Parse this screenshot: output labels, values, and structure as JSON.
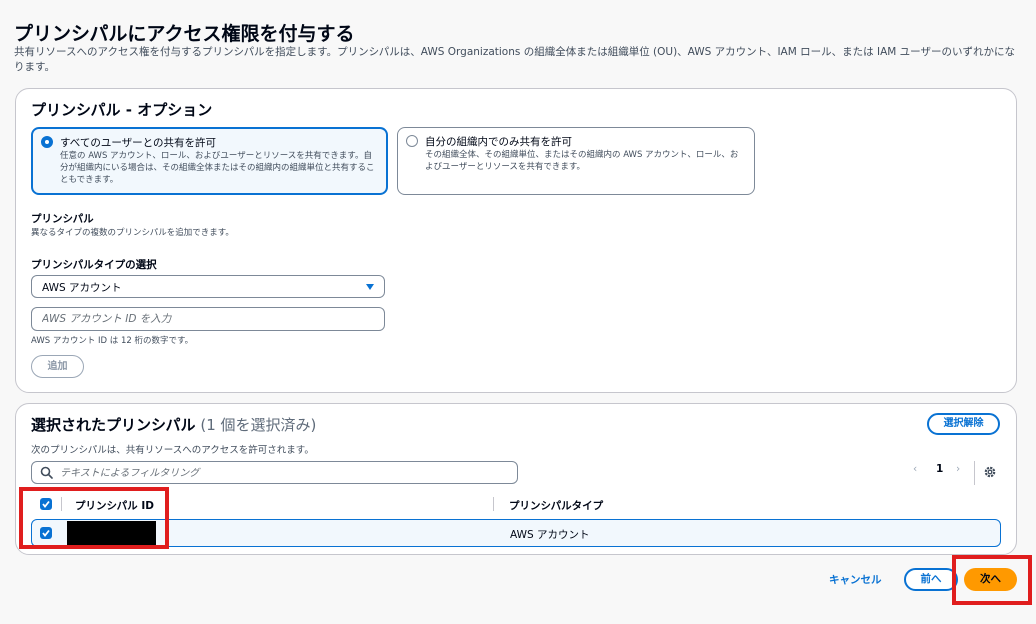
{
  "page": {
    "title": "プリンシパルにアクセス権限を付与する",
    "description": "共有リソースへのアクセス権を付与するプリンシパルを指定します。プリンシパルは、AWS Organizations の組織全体または組織単位 (OU)、AWS アカウント、IAM ロール、または IAM ユーザーのいずれかになります。"
  },
  "options": {
    "title": "プリンシパル - オプション",
    "tiles": [
      {
        "label": "すべてのユーザーとの共有を許可",
        "description": "任意の AWS アカウント、ロール、およびユーザーとリソースを共有できます。自分が組織内にいる場合は、その組織全体またはその組織内の組織単位と共有することもできます。",
        "selected": true
      },
      {
        "label": "自分の組織内でのみ共有を許可",
        "description": "その組織全体、その組織単位、またはその組織内の AWS アカウント、ロール、およびユーザーとリソースを共有できます。",
        "selected": false
      }
    ],
    "principals_label": "プリンシパル",
    "principals_hint": "異なるタイプの複数のプリンシパルを追加できます。",
    "type_label": "プリンシパルタイプの選択",
    "type_value": "AWS アカウント",
    "id_placeholder": "AWS アカウント ID を入力",
    "id_hint": "AWS アカウント ID は 12 桁の数字です。",
    "add_button": "追加"
  },
  "selected": {
    "title": "選択されたプリンシパル",
    "count": "(1 個を選択済み)",
    "description": "次のプリンシパルは、共有リソースへのアクセスを許可されます。",
    "deselect_button": "選択解除",
    "filter_placeholder": "テキストによるフィルタリング",
    "pager": {
      "prev": "‹",
      "page": "1",
      "next": "›"
    },
    "columns": [
      "プリンシパル ID",
      "プリンシパルタイプ"
    ],
    "rows": [
      {
        "id": "",
        "type": "AWS アカウント",
        "checked": true
      }
    ]
  },
  "footer": {
    "cancel": "キャンセル",
    "prev": "前へ",
    "next": "次へ"
  },
  "colors": {
    "accent": "#0972d3",
    "primary_button": "#ff9900",
    "annotation_highlight": "#e01e1e"
  }
}
